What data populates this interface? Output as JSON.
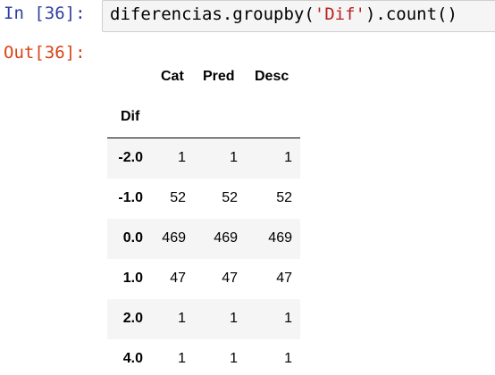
{
  "input_cell": {
    "prompt": "In [36]:",
    "code_before": "diferencias.groupby(",
    "code_string": "'Dif'",
    "code_after": ").count()"
  },
  "output_cell": {
    "prompt": "Out[36]:"
  },
  "dataframe": {
    "columns": [
      "Cat",
      "Pred",
      "Desc"
    ],
    "index_name": "Dif",
    "rows": [
      {
        "idx": "-2.0",
        "cat": "1",
        "pred": "1",
        "desc": "1"
      },
      {
        "idx": "-1.0",
        "cat": "52",
        "pred": "52",
        "desc": "52"
      },
      {
        "idx": "0.0",
        "cat": "469",
        "pred": "469",
        "desc": "469"
      },
      {
        "idx": "1.0",
        "cat": "47",
        "pred": "47",
        "desc": "47"
      },
      {
        "idx": "2.0",
        "cat": "1",
        "pred": "1",
        "desc": "1"
      },
      {
        "idx": "4.0",
        "cat": "1",
        "pred": "1",
        "desc": "1"
      }
    ]
  },
  "colors": {
    "in_prompt": "#303f9f",
    "out_prompt": "#d84315",
    "string": "#ba2121",
    "cell_bg": "#f5f5f5"
  }
}
